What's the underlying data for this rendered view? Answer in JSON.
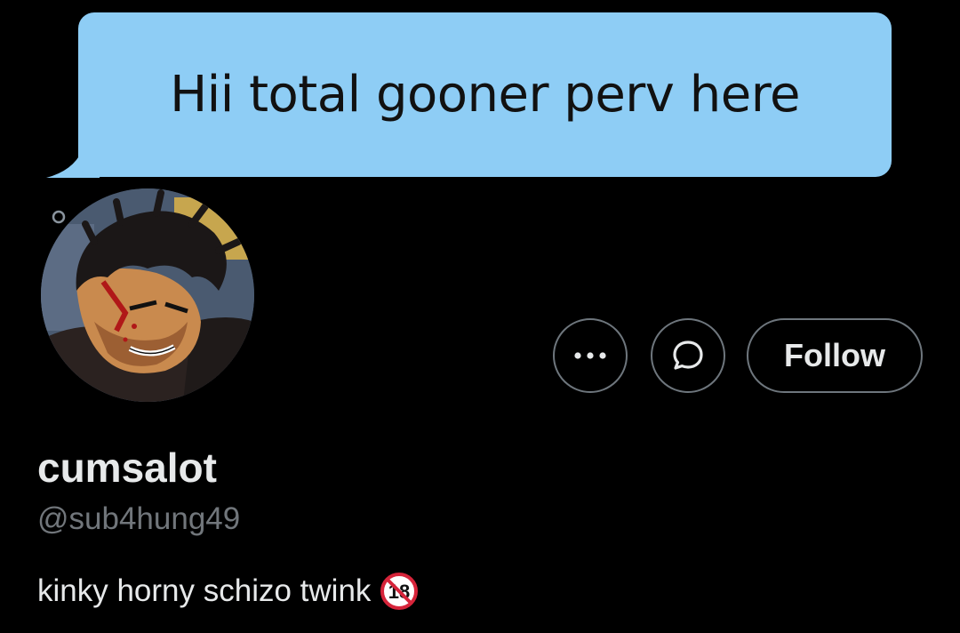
{
  "bubble": {
    "text": "Hii total gooner perv here",
    "color": "#8ecdf5"
  },
  "profile": {
    "display_name": "cumsalot",
    "handle": "@sub4hung49",
    "bio": "kinky horny schizo twink",
    "bio_emoji": "no-one-under-eighteen-icon",
    "avatar": "avatar-image"
  },
  "actions": {
    "more_icon": "more-dots-icon",
    "message_icon": "message-bubble-icon",
    "follow_label": "Follow"
  },
  "colors": {
    "background": "#000000",
    "text_primary": "#e7e9ea",
    "text_secondary": "#71767b",
    "button_border": "#6e767d",
    "no18_red": "#d6243a"
  }
}
